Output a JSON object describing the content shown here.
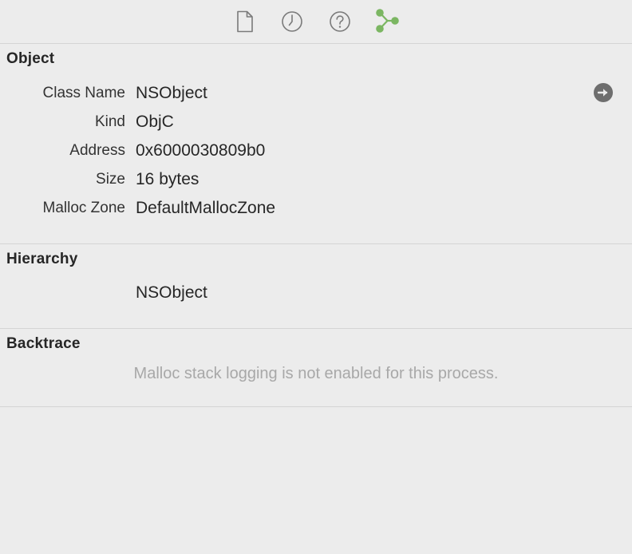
{
  "toolbar": {
    "buttons": [
      {
        "icon": "file-icon"
      },
      {
        "icon": "clock-icon"
      },
      {
        "icon": "help-icon"
      },
      {
        "icon": "graph-nodes-icon",
        "active": true,
        "color": "#7bb662"
      }
    ]
  },
  "object": {
    "title": "Object",
    "rows": [
      {
        "label": "Class Name",
        "value": "NSObject"
      },
      {
        "label": "Kind",
        "value": "ObjC"
      },
      {
        "label": "Address",
        "value": "0x6000030809b0"
      },
      {
        "label": "Size",
        "value": "16 bytes"
      },
      {
        "label": "Malloc Zone",
        "value": "DefaultMallocZone"
      }
    ],
    "goto_icon": "arrow-right-circle-icon"
  },
  "hierarchy": {
    "title": "Hierarchy",
    "items": [
      "NSObject"
    ]
  },
  "backtrace": {
    "title": "Backtrace",
    "message": "Malloc stack logging is not enabled for this process."
  },
  "colors": {
    "background": "#ececec",
    "divider": "#d4d4d4",
    "icon_gray": "#7a7a7a",
    "accent_green": "#7bb662",
    "muted_text": "#a8a8a8"
  }
}
